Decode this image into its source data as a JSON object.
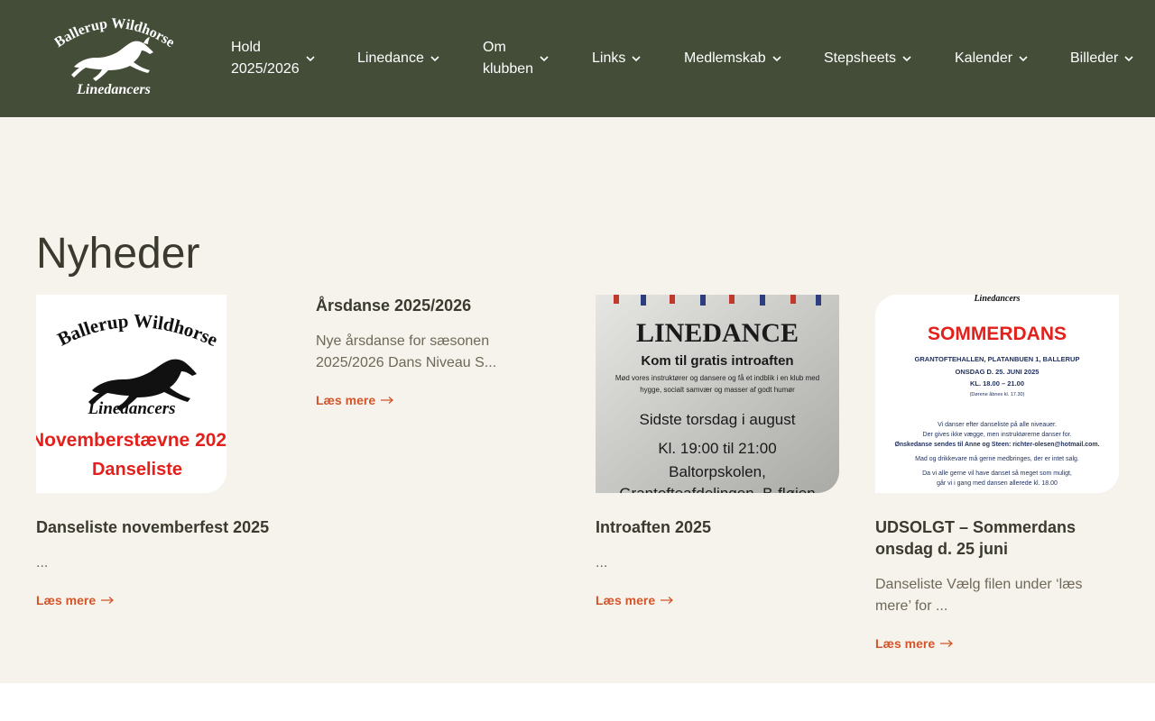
{
  "header": {
    "logo": {
      "top_text": "Ballerup Wildhorse",
      "bottom_text": "Linedancers",
      "icon": "horse-icon"
    },
    "nav": [
      {
        "label_line1": "Hold",
        "label_line2": "2025/2026"
      },
      {
        "label_line1": "Linedance",
        "label_line2": ""
      },
      {
        "label_line1": "Om",
        "label_line2": "klubben"
      },
      {
        "label_line1": "Links",
        "label_line2": ""
      },
      {
        "label_line1": "Medlemskab",
        "label_line2": ""
      },
      {
        "label_line1": "Stepsheets",
        "label_line2": ""
      },
      {
        "label_line1": "Kalender",
        "label_line2": ""
      },
      {
        "label_line1": "Billeder",
        "label_line2": ""
      }
    ],
    "chevron_icon": "chevron-down-icon"
  },
  "main": {
    "title": "Nyheder",
    "read_more": "Læs mere",
    "cards": [
      {
        "title": "Danseliste novemberfest 2025",
        "excerpt": "...",
        "image": {
          "line1": "Ballerup Wildhorse",
          "line2": "Linedancers",
          "line3": "Novemberstævne 202",
          "line4": "Danseliste"
        }
      },
      {
        "title": "Årsdanse 2025/2026",
        "excerpt": "Nye årsdanse for sæsonen 2025/2026   Dans Niveau S..."
      },
      {
        "title": "Introaften 2025",
        "excerpt": "...",
        "image": {
          "line1": "LINEDANCE",
          "line2": "Kom til gratis introaften",
          "line3": "Mød vores instruktører og dansere og få et indblik i en klub med",
          "line4": "hygge, socialt samvær og masser af godt humør",
          "line5": "Sidste torsdag i august",
          "line6": "Kl. 19:00 til 21:00",
          "line7": "Baltorpskolen,",
          "line8": "Grantofteafdelingen, B-fløjen"
        }
      },
      {
        "title": "UDSOLGT – Sommerdans onsdag d. 25 juni",
        "excerpt": "Danseliste Vælg filen under ‘læs mere’ for ...",
        "image": {
          "line1": "Linedancers",
          "line2": "SOMMERDANS",
          "line3": "GRANTOFTEHALLEN, PLATANBUEN 1, BALLERUP",
          "line4": "ONSDAG D. 25. JUNI 2025",
          "line5": "KL. 18.00 – 21.00",
          "line6": "(Dørene åbnes kl. 17.30)",
          "line7": "Vi danser efter danseliste på alle niveauer.",
          "line8": "Der gives ikke vægge, men instruktørerne danser for.",
          "line9": "Ønskedanse sendes til Anne og Steen: richter-olesen@hotmail.com.",
          "line10": "Mad og drikkevare må gerne medbringes, der er intet salg.",
          "line11": "Da vi alle gerne vil have danset så meget som muligt,",
          "line12": "går vi i gang med dansen allerede kl. 18.00"
        }
      }
    ]
  },
  "colors": {
    "header_bg": "#434d37",
    "page_bg": "#f6f3ec",
    "accent": "#d2562a",
    "title_text": "#3a3a2e",
    "muted_text": "#6f6858"
  }
}
